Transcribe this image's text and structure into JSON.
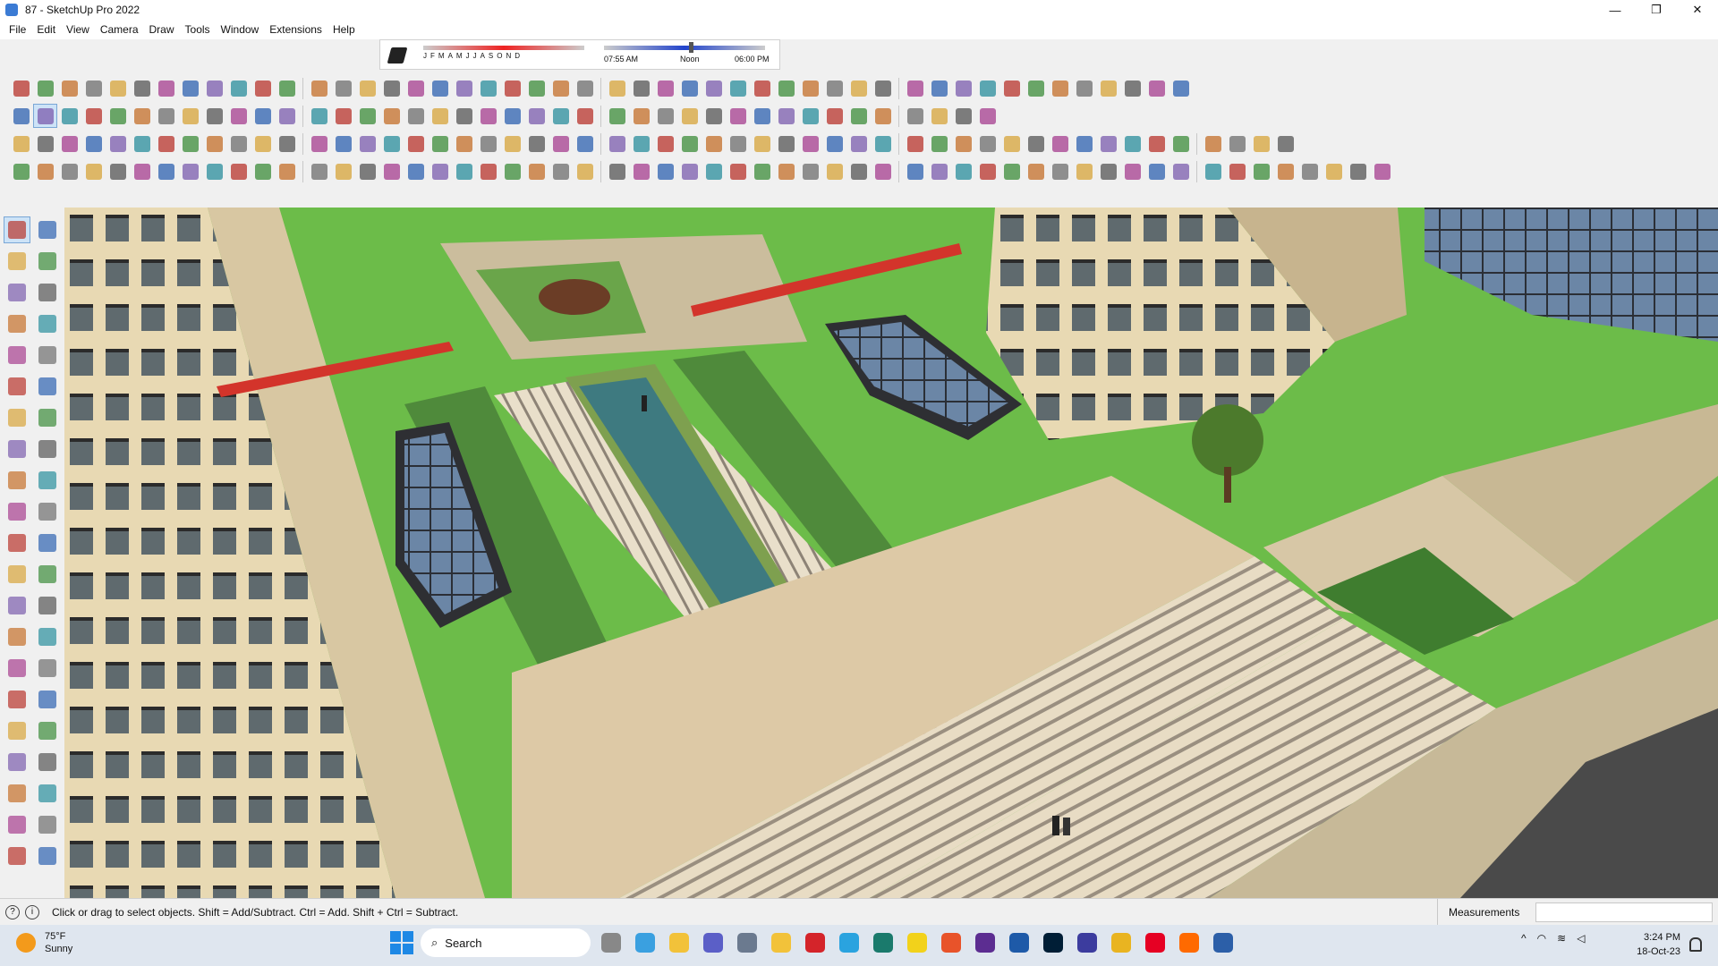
{
  "window": {
    "title": "87 - SketchUp Pro 2022",
    "minimize_glyph": "—",
    "maximize_glyph": "❐",
    "close_glyph": "✕"
  },
  "menu": [
    "File",
    "Edit",
    "View",
    "Camera",
    "Draw",
    "Tools",
    "Window",
    "Extensions",
    "Help"
  ],
  "shadows": {
    "months": [
      "J",
      "F",
      "M",
      "A",
      "M",
      "J",
      "J",
      "A",
      "S",
      "O",
      "N",
      "D"
    ],
    "time_start": "07:55 AM",
    "time_mid": "Noon",
    "time_end": "06:00 PM"
  },
  "toolbar_rows": [
    {
      "name": "row-1",
      "count": 48
    },
    {
      "name": "row-2",
      "count": 40
    },
    {
      "name": "row-3",
      "count": 52
    },
    {
      "name": "row-4",
      "count": 56
    }
  ],
  "left_tools": [
    [
      "select-tool",
      "orbit-tool"
    ],
    [
      "paint-bucket-tool",
      "eraser-tool"
    ],
    [
      "component-tool",
      "tape-tool"
    ],
    [
      "line-tool",
      "freehand-tool"
    ],
    [
      "rectangle-tool",
      "rotated-rectangle-tool"
    ],
    [
      "circle-tool",
      "polygon-tool"
    ],
    [
      "arc-tool",
      "two-point-arc-tool"
    ],
    [
      "pie-tool",
      "three-point-arc-tool"
    ],
    [
      "move-tool",
      "push-pull-tool"
    ],
    [
      "rotate-tool",
      "follow-me-tool"
    ],
    [
      "scale-tool",
      "offset-tool"
    ],
    [
      "tape-measure-tool",
      "dimension-tool"
    ],
    [
      "protractor-tool",
      "text-tool"
    ],
    [
      "axes-tool",
      "3d-text-tool"
    ],
    [
      "orbit-camera-tool",
      "pan-tool"
    ],
    [
      "zoom-tool",
      "zoom-window-tool"
    ],
    [
      "zoom-extents-tool",
      "previous-view-tool"
    ],
    [
      "position-camera-tool",
      "look-around-tool"
    ],
    [
      "walk-tool",
      "section-plane-tool"
    ],
    [
      "sandbox-from-contours-tool",
      "sandbox-from-scratch-tool"
    ],
    [
      "smoove-tool",
      "stamp-tool"
    ]
  ],
  "status": {
    "hint": "Click or drag to select objects. Shift = Add/Subtract. Ctrl = Add. Shift + Ctrl = Subtract.",
    "measurements_label": "Measurements",
    "measurements_value": ""
  },
  "taskbar": {
    "temperature": "75°F",
    "condition": "Sunny",
    "search_label": "Search",
    "apps": [
      "task-view",
      "edge-copilot",
      "file-explorer-window",
      "teams",
      "calculator",
      "file-explorer",
      "opera",
      "telegram",
      "photo-app",
      "sticky-notes",
      "brave",
      "visual-studio",
      "another-app",
      "photoshop",
      "affinity",
      "chrome",
      "pinterest",
      "soundcloud",
      "sketchup"
    ],
    "time": "3:24 PM",
    "date": "18-Oct-23"
  }
}
